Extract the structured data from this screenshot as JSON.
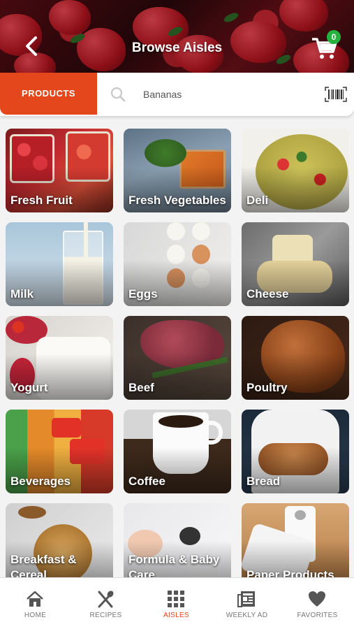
{
  "header": {
    "title": "Browse Aisles",
    "cart_count": "0"
  },
  "search": {
    "tab_label": "PRODUCTS",
    "value": "Bananas"
  },
  "aisles": [
    {
      "label": "Fresh Fruit"
    },
    {
      "label": "Fresh Vegetables"
    },
    {
      "label": "Deli"
    },
    {
      "label": "Milk"
    },
    {
      "label": "Eggs"
    },
    {
      "label": "Cheese"
    },
    {
      "label": "Yogurt"
    },
    {
      "label": "Beef"
    },
    {
      "label": "Poultry"
    },
    {
      "label": "Beverages"
    },
    {
      "label": "Coffee"
    },
    {
      "label": "Bread"
    },
    {
      "label": "Breakfast & Cereal"
    },
    {
      "label": "Formula & Baby Care"
    },
    {
      "label": "Paper Products"
    }
  ],
  "nav": {
    "home": "HOME",
    "recipes": "RECIPES",
    "aisles": "AISLES",
    "weekly_ad": "WEEKLY AD",
    "favorites": "FAVORITES"
  },
  "colors": {
    "accent": "#e3471b",
    "badge": "#27b23f"
  }
}
